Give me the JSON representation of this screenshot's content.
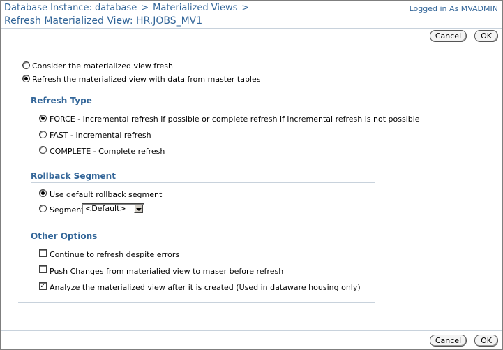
{
  "header": {
    "breadcrumb": [
      "Database Instance: database",
      "Materialized Views"
    ],
    "breadcrumb_separator": ">",
    "logged_in": "Logged in As MVADMIN",
    "title": "Refresh Materialized View: HR.JOBS_MV1"
  },
  "buttons": {
    "cancel": "Cancel",
    "ok": "OK"
  },
  "refresh_mode": {
    "options": [
      {
        "label": "Consider the materialized view fresh",
        "checked": false
      },
      {
        "label": "Refresh the materialized view with data from master tables",
        "checked": true
      }
    ]
  },
  "refresh_type": {
    "header": "Refresh Type",
    "options": [
      {
        "label": "FORCE - Incremental refresh if possible or complete refresh if incremental refresh is not possible",
        "checked": true
      },
      {
        "label": "FAST - Incremental refresh",
        "checked": false
      },
      {
        "label": "COMPLETE - Complete refresh",
        "checked": false
      }
    ]
  },
  "rollback_segment": {
    "header": "Rollback Segment",
    "options": [
      {
        "label": "Use default rollback segment",
        "checked": true
      },
      {
        "label": "Segment",
        "checked": false
      }
    ],
    "segment_select_value": "<Default>"
  },
  "other_options": {
    "header": "Other Options",
    "options": [
      {
        "label": "Continue to refresh despite errors",
        "checked": false
      },
      {
        "label": "Push Changes from materialied view to maser before refresh",
        "checked": false
      },
      {
        "label": "Analyze the materialized view after it is created (Used in dataware housing only)",
        "checked": true
      }
    ]
  },
  "colors": {
    "accent": "#336699",
    "rule": "#c8d2dc"
  }
}
